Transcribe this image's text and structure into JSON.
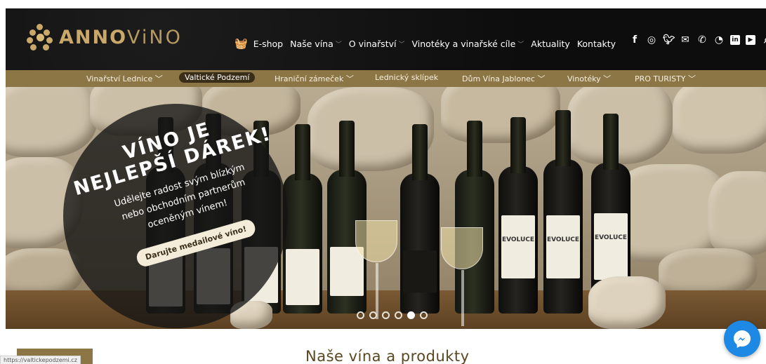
{
  "logo": {
    "part1": "ANNO",
    "part2": "ViNO"
  },
  "main_nav": [
    {
      "label": "E-shop",
      "has_dropdown": false
    },
    {
      "label": "Naše vína",
      "has_dropdown": true
    },
    {
      "label": "O vinařství",
      "has_dropdown": true
    },
    {
      "label": "Vinotéky a vinařské cíle",
      "has_dropdown": true
    },
    {
      "label": "Aktuality",
      "has_dropdown": false
    },
    {
      "label": "Kontakty",
      "has_dropdown": false
    }
  ],
  "social_icons": [
    "facebook-icon",
    "instagram-icon",
    "twitter-icon",
    "mail-icon",
    "phone-icon",
    "rss-icon",
    "linkedin-icon",
    "youtube-icon",
    "search-icon"
  ],
  "sub_nav": [
    {
      "label": "Vinařství Lednice",
      "has_dropdown": true,
      "active": false
    },
    {
      "label": "Valtické Podzemí",
      "has_dropdown": false,
      "active": true
    },
    {
      "label": "Hraniční zámeček",
      "has_dropdown": true,
      "active": false
    },
    {
      "label": "Lednický sklípek",
      "has_dropdown": false,
      "active": false
    },
    {
      "label": "Dům Vína Jablonec",
      "has_dropdown": true,
      "active": false
    },
    {
      "label": "Vinotéky",
      "has_dropdown": true,
      "active": false
    },
    {
      "label": "PRO TURISTY",
      "has_dropdown": true,
      "active": false
    }
  ],
  "hero": {
    "title_line1": "VÍNO JE",
    "title_line2": "NEJLEPŠÍ DÁREK!",
    "subtitle_line1": "Udělejte radost svým blízkým",
    "subtitle_line2": "nebo obchodním partnerům",
    "subtitle_line3": "oceněným vínem!",
    "cta": "Darujte medailové víno!",
    "bottle_labels": [
      "EVOLUCE",
      "EVOLUCE",
      "EVOLUCE"
    ],
    "slides_count": 6,
    "active_slide": 4
  },
  "section_title": "Naše vína a produkty",
  "status_url": "https://valtickepodzemi.cz",
  "colors": {
    "header_bg": "#0f0f0f",
    "gold": "#c9a86a",
    "subnav_bg": "#8c7646",
    "messenger": "#1e88e5"
  }
}
